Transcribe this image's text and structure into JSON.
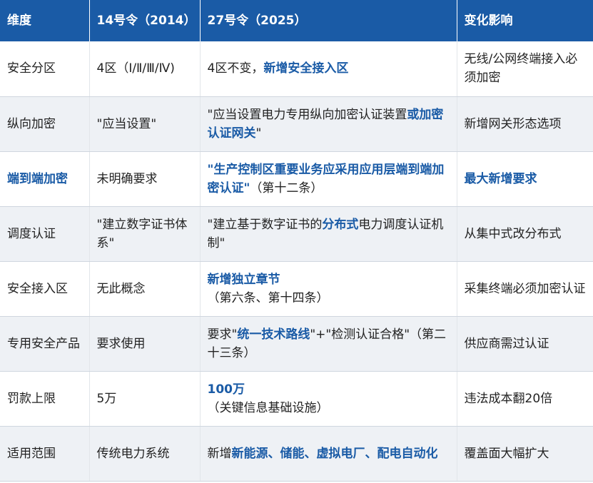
{
  "header": {
    "col1": "维度",
    "col2": "14号令（2014）",
    "col3": "27号令（2025）",
    "col4": "变化影响"
  },
  "rows": [
    {
      "dimension": "安全分区",
      "old": "4区（Ⅰ/Ⅱ/Ⅲ/Ⅳ)",
      "new_pre": "4区不变，",
      "new_hl": "新增安全接入区",
      "impact": "无线/公网终端接入必须加密"
    },
    {
      "dimension": "纵向加密",
      "old": "\"应当设置\"",
      "new_pre": "\"应当设置电力专用纵向加密认证装置",
      "new_hl": "或加密认证网关",
      "new_post": "\"",
      "impact": "新增网关形态选项"
    },
    {
      "dimension": "端到端加密",
      "old": "未明确要求",
      "new_hl": "\"生产控制区重要业务应采用应用层端到端加密认证\"",
      "new_post": "（第十二条）",
      "impact": "最大新增要求"
    },
    {
      "dimension": "调度认证",
      "old": "\"建立数字证书体系\"",
      "new_pre": "\"建立基于数字证书的",
      "new_hl": "分布式",
      "new_post": "电力调度认证机制\"",
      "impact": "从集中式改分布式"
    },
    {
      "dimension": "安全接入区",
      "old": "无此概念",
      "new_hl": "新增独立章节",
      "new_line2": "（第六条、第十四条）",
      "impact": "采集终端必须加密认证"
    },
    {
      "dimension": "专用安全产品",
      "old": "要求使用",
      "new_pre": "要求\"",
      "new_hl": "统一技术路线",
      "new_post": "\"+\"检测认证合格\"（第二十三条）",
      "impact": "供应商需过认证"
    },
    {
      "dimension": "罚款上限",
      "old": "5万",
      "new_hl": "100万",
      "new_line2": "（关键信息基础设施）",
      "impact": "违法成本翻20倍"
    },
    {
      "dimension": "适用范围",
      "old": "传统电力系统",
      "new_pre": "新增",
      "new_hl": "新能源、储能、虚拟电厂、配电自动化",
      "impact": "覆盖面大幅扩大"
    }
  ]
}
